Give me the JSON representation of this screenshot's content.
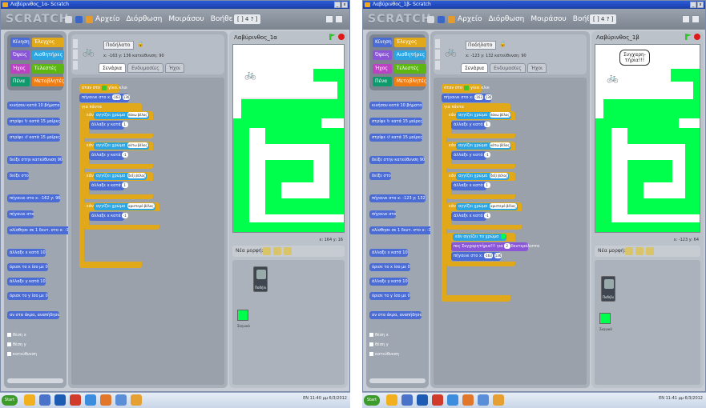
{
  "windows": [
    {
      "id": "left",
      "title": "Λαβύρινθος_1α- Scratch",
      "menus": [
        "Αρχείο",
        "Διόρθωση",
        "Μοιράσου",
        "Βοήθεια"
      ],
      "logo": "SCRATCH",
      "zoom_label": "[ ] 4 ? ]",
      "categories": [
        "Κίνηση",
        "Έλεγχος",
        "Όψεις",
        "Αισθητήρες",
        "Ήχος",
        "Τελεστές",
        "Πένα",
        "Μεταβλητές"
      ],
      "palette": [
        "κινήσου κατά 10 βήματα",
        "στρίψε ↻ κατά 15 μοίρες",
        "στρίψε ↺ κατά 15 μοίρες",
        "δείξε στην κατεύθυνση 90",
        "δείξε στο",
        "πήγαινε στο x: -162 y: 96",
        "πήγαινε στο",
        "ολίσθησε σε 1 δευτ. στο x: -162",
        "άλλαξε x κατά 10",
        "όρισε το x ίσο με 0",
        "άλλαξε y κατά 10",
        "όρισε το y ίσο με 0",
        "αν στα άκρα, αναπήδησε",
        "θέση x",
        "θέση y",
        "κατεύθυνση"
      ],
      "sprite": {
        "name": "Ποδήλατο",
        "coords": "x: -163  y: 136   κατεύθυνση: 90"
      },
      "tabs": [
        "Σενάρια",
        "Ενδυμασίες",
        "Ήχοι"
      ],
      "scripts": {
        "hat": "όταν στο",
        "hat_suffix": "γίνει κλικ",
        "goto": "πήγαινε στο x:",
        "goto_x": "-163",
        "goto_y": "136",
        "forever": "για πάντα",
        "if_label": "εάν",
        "touch_label": "αγγίζει χρώμα",
        "cond1": "πάνω βέλος",
        "cond2": "κάτω βέλος",
        "cond3": "δεξί βέλος",
        "cond4": "αριστερό βέλος",
        "act1": "άλλαξε y κατά",
        "act1_v": "1",
        "act2": "άλλαξε y κατά",
        "act2_v": "-1",
        "act3": "άλλαξε x κατά",
        "act3_v": "1",
        "act4": "άλλαξε x κατά",
        "act4_v": "-1"
      },
      "stage_title": "Λαβύρινθος_1α",
      "stage_coords": "x: 164   y: 16",
      "new_sprite": "Νέα μορφή:",
      "sprite_list_label": "Ποδήλατ...",
      "stage_label": "Σκηνικό",
      "taskbar": {
        "start": "Start",
        "tray": "EN  11:40 μμ  6/3/2012"
      }
    },
    {
      "id": "right",
      "title": "Λαβύρινθος_1β- Scratch",
      "menus": [
        "Αρχείο",
        "Διόρθωση",
        "Μοιράσου",
        "Βοήθεια"
      ],
      "logo": "SCRATCH",
      "zoom_label": "[ ] 4 ? ]",
      "categories": [
        "Κίνηση",
        "Έλεγχος",
        "Όψεις",
        "Αισθητήρες",
        "Ήχος",
        "Τελεστές",
        "Πένα",
        "Μεταβλητές"
      ],
      "palette": [
        "κινήσου κατά 10 βήματα",
        "στρίψε ↻ κατά 15 μοίρες",
        "στρίψε ↺ κατά 15 μοίρες",
        "δείξε στην κατεύθυνση 90",
        "δείξε στο",
        "πήγαινε στο x: -123 y: 132",
        "πήγαινε στο",
        "ολίσθησε σε 1 δευτ. στο x: -123",
        "άλλαξε x κατά 10",
        "όρισε το x ίσο με 0",
        "άλλαξε y κατά 10",
        "όρισε το y ίσο με 0",
        "αν στα άκρα, αναπήδησε",
        "θέση x",
        "θέση y",
        "κατεύθυνση"
      ],
      "sprite": {
        "name": "Ποδήλατο",
        "coords": "x: -123  y: 132   κατεύθυνση: 90"
      },
      "tabs": [
        "Σενάρια",
        "Ενδυμασίες",
        "Ήχοι"
      ],
      "scripts": {
        "hat": "όταν στο",
        "hat_suffix": "γίνει κλικ",
        "goto": "πήγαινε στο x:",
        "goto_x": "-163",
        "goto_y": "136",
        "forever": "για πάντα",
        "if_label": "εάν",
        "touch_label": "αγγίζει χρώμα",
        "cond1": "πάνω βέλος",
        "cond2": "κάτω βέλος",
        "cond3": "δεξί βέλος",
        "cond4": "αριστερό βέλος",
        "act1": "άλλαξε y κατά",
        "act1_v": "1",
        "act2": "άλλαξε y κατά",
        "act2_v": "-1",
        "act3": "άλλαξε x κατά",
        "act3_v": "1",
        "act4": "άλλαξε x κατά",
        "act4_v": "-1",
        "extra1": "εάν αγγίζει το χρώμα",
        "extra2": "πες Συγχαρητήρια!!!",
        "extra2_for": "για",
        "extra2_v": "2",
        "extra2_unit": "δευτερόλεπτα",
        "extra3": "πήγαινε στο x:",
        "extra3_x": "-163",
        "extra3_y": "136"
      },
      "stage_title": "Λαβύρινθος_1β",
      "speech": "Συγχαρη-\nτήρια!!!",
      "stage_coords": "x: -123   y: 64",
      "new_sprite": "Νέα μορφή:",
      "sprite_list_label": "Ποδήλατ...",
      "stage_label": "Σκηνικό",
      "taskbar": {
        "start": "Start",
        "tray": "EN  11:41 μμ  6/3/2012"
      }
    }
  ],
  "colors": {
    "maze_green": "#00ff4c",
    "maze_path": "#e6e6e6",
    "control": "#e1a91a",
    "motion": "#4a6cd4",
    "looks": "#8a55d7",
    "sensing": "#2ca5e2"
  }
}
